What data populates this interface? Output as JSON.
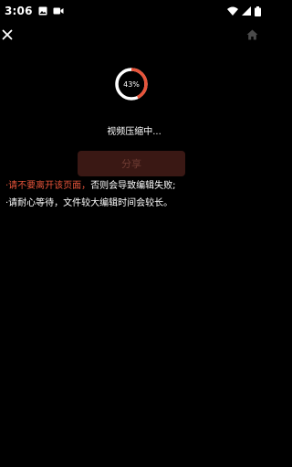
{
  "status_bar": {
    "time": "3:06",
    "left_icons": [
      "image-icon",
      "video-camera-icon"
    ],
    "right_icons": [
      "wifi-icon",
      "signal-icon",
      "battery-icon"
    ]
  },
  "nav": {
    "close_icon": "close-icon",
    "home_icon": "home-icon"
  },
  "progress": {
    "percent": 43,
    "label": "43%",
    "color": "#e8543a",
    "track_color": "#ffffff"
  },
  "status_text": "视频压缩中...",
  "share_button": {
    "label": "分享",
    "enabled": false
  },
  "notes": {
    "line1_red": "·请不要离开该页面，",
    "line1_white": "否则会导致编辑失败;",
    "line2": "·请耐心等待，文件较大编辑时间会较长。"
  },
  "colors": {
    "accent": "#e8543a",
    "background": "#000000",
    "button_disabled_bg": "#3a1814"
  }
}
